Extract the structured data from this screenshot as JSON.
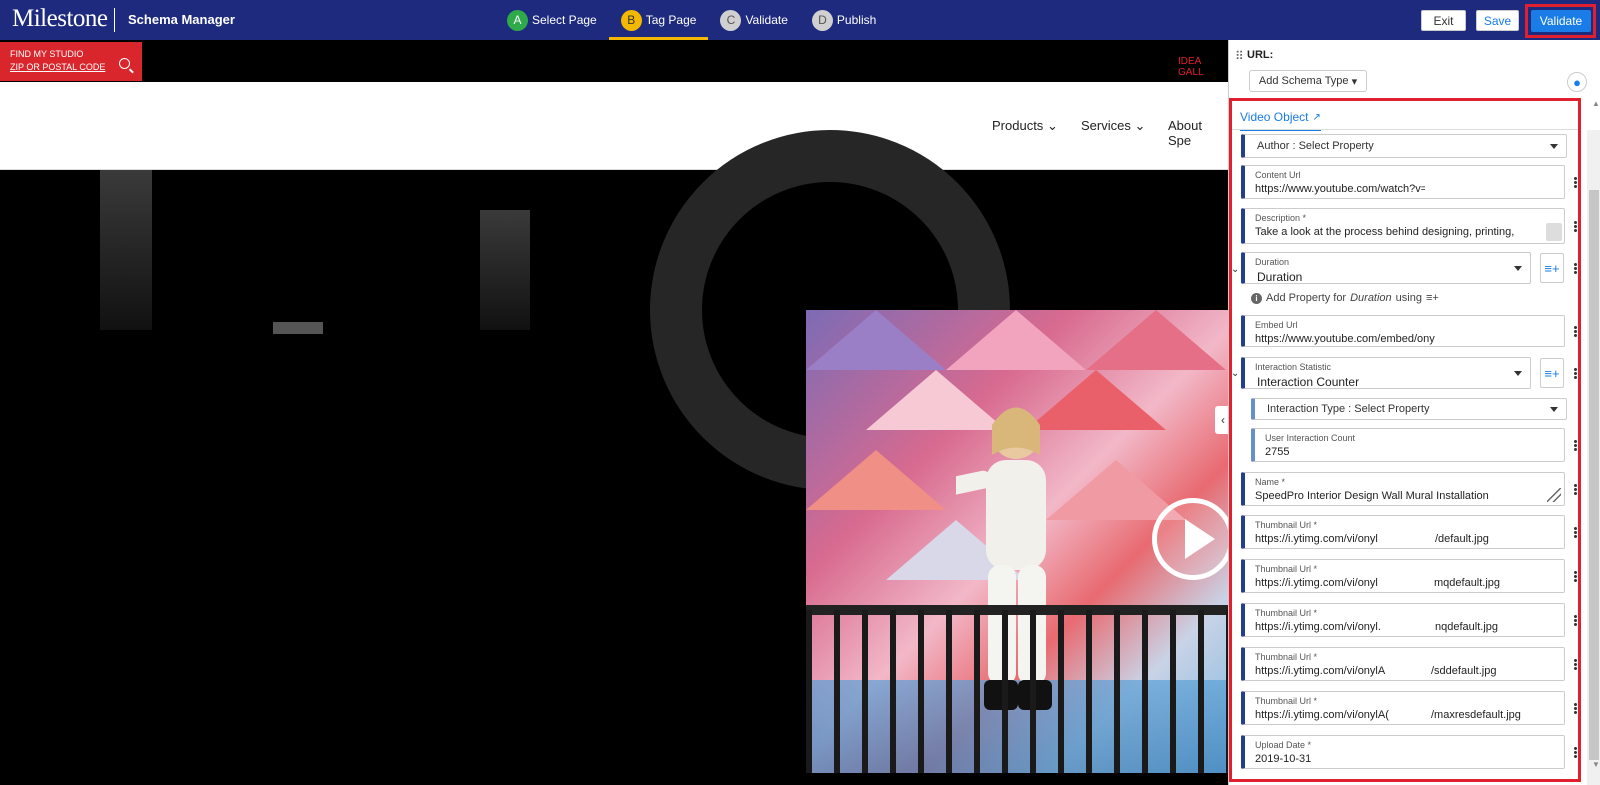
{
  "topbar": {
    "logo": "Milestone",
    "app_title": "Schema Manager",
    "steps": [
      {
        "letter": "A",
        "label": "Select Page",
        "color": "#2eaa4a"
      },
      {
        "letter": "B",
        "label": "Tag Page",
        "color": "#f5b800"
      },
      {
        "letter": "C",
        "label": "Validate",
        "color": "#d0d0d0"
      },
      {
        "letter": "D",
        "label": "Publish",
        "color": "#d0d0d0"
      }
    ],
    "exit_label": "Exit",
    "save_label": "Save",
    "validate_label": "Validate"
  },
  "site": {
    "find_studio_line1": "FIND MY STUDIO",
    "find_studio_line2": "ZIP OR POSTAL CODE",
    "idea_link": "IDEA GALL",
    "nav": [
      "Products",
      "Services",
      "About Spe"
    ]
  },
  "panel": {
    "url_label": "URL:",
    "add_schema_label": "Add Schema Type",
    "tab_label": "Video Object",
    "author_select": "Author : Select Property",
    "content_url": {
      "label": "Content Url",
      "value": "https://www.youtube.com/watch?v="
    },
    "description": {
      "label": "Description *",
      "value": "Take a look at the process behind designing, printing,"
    },
    "duration": {
      "label": "Duration",
      "value": "Duration"
    },
    "add_property_hint": {
      "prefix": "Add Property for",
      "name": "Duration",
      "suffix": "using"
    },
    "embed_url": {
      "label": "Embed Url",
      "value": "https://www.youtube.com/embed/ony"
    },
    "interaction_statistic": {
      "label": "Interaction Statistic",
      "value": "Interaction Counter"
    },
    "interaction_type_select": "Interaction Type : Select Property",
    "user_interaction_count": {
      "label": "User Interaction Count",
      "value": "2755"
    },
    "name": {
      "label": "Name *",
      "value": "SpeedPro Interior Design Wall Mural Installation"
    },
    "thumbnails": [
      {
        "label": "Thumbnail Url *",
        "value_start": "https://i.ytimg.com/vi/onyl",
        "value_end": "/default.jpg"
      },
      {
        "label": "Thumbnail Url *",
        "value_start": "https://i.ytimg.com/vi/onyl",
        "value_end": "mqdefault.jpg"
      },
      {
        "label": "Thumbnail Url *",
        "value_start": "https://i.ytimg.com/vi/onyl.",
        "value_end": "nqdefault.jpg"
      },
      {
        "label": "Thumbnail Url *",
        "value_start": "https://i.ytimg.com/vi/onylA",
        "value_end": "/sddefault.jpg"
      },
      {
        "label": "Thumbnail Url *",
        "value_start": "https://i.ytimg.com/vi/onylA(",
        "value_end": "/maxresdefault.jpg"
      }
    ],
    "upload_date": {
      "label": "Upload Date *",
      "value": "2019-10-31"
    }
  },
  "colors": {
    "topbar": "#1d2a7e",
    "accent": "#1a7ce6",
    "highlight": "#e0202e",
    "field_border": "#233e8b"
  }
}
